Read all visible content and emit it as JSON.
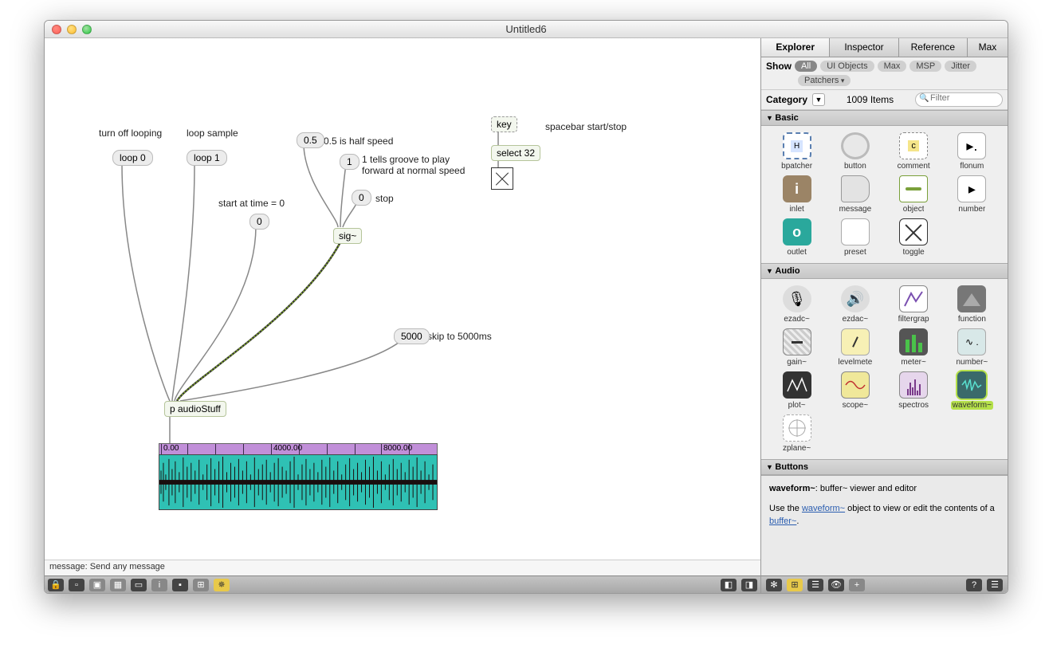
{
  "window_title": "Untitled6",
  "canvas": {
    "comments": {
      "c1": "turn off looping",
      "c2": "loop sample",
      "c3": "0.5 is half speed",
      "c4": "1 tells groove to play forward at normal speed",
      "c5": "stop",
      "c6": "start at time = 0",
      "c7": "spacebar start/stop",
      "c8": "skip to 5000ms"
    },
    "messages": {
      "m1": "loop 0",
      "m2": "loop 1",
      "m3": "0.5",
      "m4": "1",
      "m5": "0",
      "m6": "0",
      "m7": "5000"
    },
    "objects": {
      "o1": "key",
      "o2": "select 32",
      "o3": "sig~",
      "o4": "p audioStuff"
    },
    "waveform_ticks": [
      "0.00",
      "4000.00",
      "8000.00"
    ]
  },
  "statusbar_text": "message: Send any message",
  "side": {
    "tabs": [
      "Explorer",
      "Inspector",
      "Reference",
      "Max"
    ],
    "show_label": "Show",
    "filters": [
      "All",
      "UI Objects",
      "Max",
      "MSP",
      "Jitter",
      "Patchers"
    ],
    "category_label": "Category",
    "item_count": "1009 Items",
    "search_placeholder": "Filter",
    "sections": {
      "basic": {
        "title": "Basic",
        "items": [
          "bpatcher",
          "button",
          "comment",
          "flonum",
          "inlet",
          "message",
          "object",
          "number",
          "outlet",
          "preset",
          "toggle"
        ]
      },
      "audio": {
        "title": "Audio",
        "items": [
          "ezadc~",
          "ezdac~",
          "filtergrap",
          "function",
          "gain~",
          "levelmete",
          "meter~",
          "number~",
          "plot~",
          "scope~",
          "spectros",
          "waveform~",
          "zplane~"
        ]
      },
      "buttons": {
        "title": "Buttons"
      }
    },
    "help_title": "waveform~",
    "help_desc": ": buffer~ viewer and editor",
    "help_text1": "Use the ",
    "help_link1": "waveform~",
    "help_text2": " object to view or edit the contents of a ",
    "help_link2": "buffer~",
    "help_text3": "."
  }
}
